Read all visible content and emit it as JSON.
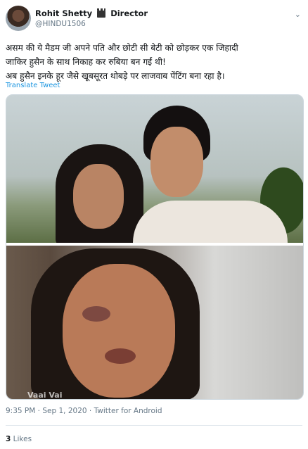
{
  "author": {
    "display_name": "Rohit Shetty",
    "title_suffix": "Director",
    "handle": "@HINDU1506",
    "badge_icon": "clapperboard-icon"
  },
  "tweet": {
    "line1": "असम की ये मैडम जी अपने पति और छोटी सी बेटी को छोड़कर एक जिहादी",
    "line2": "जाकिर हुसैन के साथ निकाह कर रुबिया बन गईं थी!",
    "line3": "अब हुसैन इनके हूर जैसे खूबसूरत थोबड़े पर लाजवाब पेंटिंग बना रहा है।",
    "translate_label": "Translate Tweet"
  },
  "media": {
    "watermark": "Vaai Vai"
  },
  "meta": {
    "time": "9:35 PM",
    "date": "Sep 1, 2020",
    "source": "Twitter for Android",
    "dot": "·"
  },
  "stats": {
    "likes_count": "3",
    "likes_label": "Likes"
  },
  "colors": {
    "link": "#1b95e0",
    "muted": "#657786",
    "border": "#ccd6dd"
  }
}
